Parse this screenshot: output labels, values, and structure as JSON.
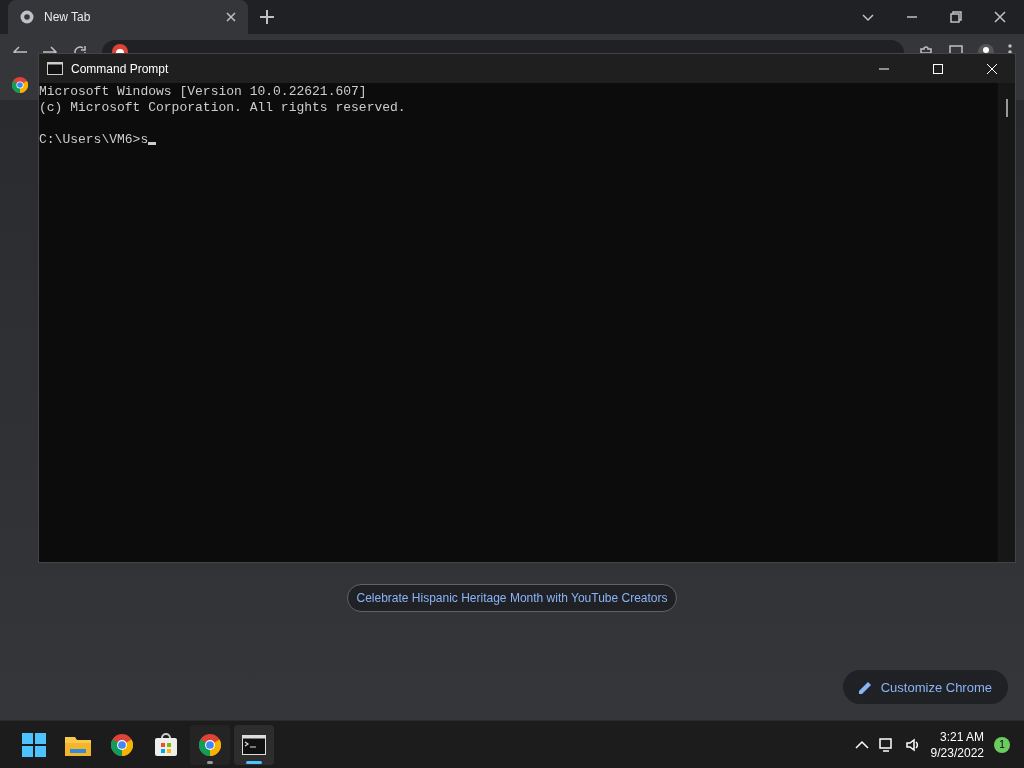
{
  "browser": {
    "tab": {
      "title": "New Tab",
      "selected": true
    },
    "promo": "Celebrate Hispanic Heritage Month with YouTube Creators",
    "customize": "Customize Chrome"
  },
  "console": {
    "title": "Command Prompt",
    "blocks": [
      [
        "Microsoft Windows [Version 10.0.22621.607]",
        "(c) Microsoft Corporation. All rights reserved."
      ],
      [
        "C:\\Users\\VM6>s"
      ]
    ]
  },
  "taskbar": {
    "apps": [
      {
        "kind": "start",
        "active": false
      },
      {
        "kind": "folder",
        "active": false
      },
      {
        "kind": "chrome",
        "active": false
      },
      {
        "kind": "store",
        "active": false
      },
      {
        "kind": "chrome",
        "active": true
      },
      {
        "kind": "terminal",
        "active": true
      }
    ],
    "time": "3:21 AM",
    "date": "9/23/2022",
    "badge": "1"
  }
}
